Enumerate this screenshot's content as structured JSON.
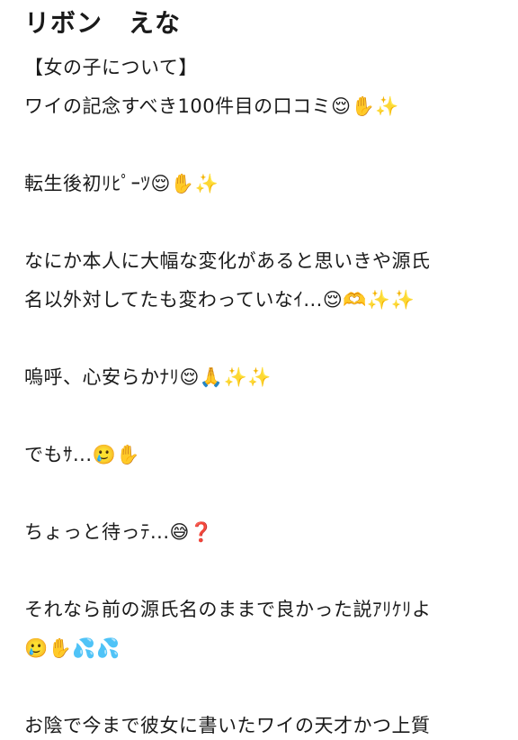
{
  "post": {
    "title": "リボン　えな",
    "lines": [
      "【女の子について】",
      "ワイの記念すべき100件目の口コミ😌✋✨",
      "転生後初ﾘﾋﾟｰﾂ😌✋✨",
      "なにか本人に大幅な変化があると思いきや源氏",
      "名以外対してたも変わっていなｲ...😌🫶✨✨",
      "嗚呼、心安らかﾅﾘ😌🙏✨✨",
      "でもｻ...🥲✋",
      "ちょっと待っﾃ...😅❓",
      "それなら前の源氏名のままで良かった説ｱﾘｹﾘよ",
      "🥲✋💦💦",
      "お陰で今まで彼女に書いたワイの天才かつ上質"
    ]
  }
}
